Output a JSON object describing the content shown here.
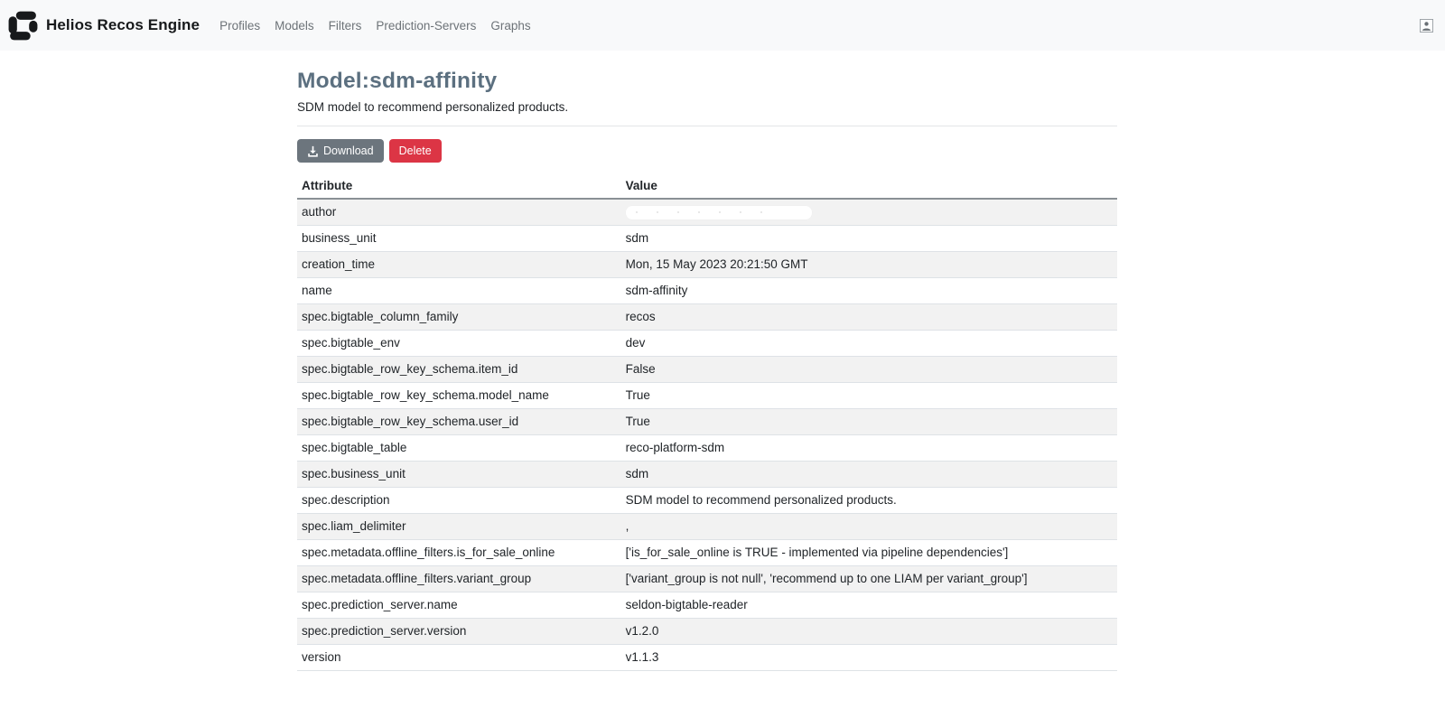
{
  "navbar": {
    "brand": "Helios Recos Engine",
    "items": [
      {
        "label": "Profiles"
      },
      {
        "label": "Models"
      },
      {
        "label": "Filters"
      },
      {
        "label": "Prediction-Servers"
      },
      {
        "label": "Graphs"
      }
    ],
    "icons": {
      "logo": "helios-logo-icon",
      "user": "user-avatar-icon"
    }
  },
  "page": {
    "title": "Model:sdm-affinity",
    "subtitle": "SDM model to recommend personalized products."
  },
  "toolbar": {
    "download_label": "Download",
    "delete_label": "Delete",
    "download_icon": "download-icon"
  },
  "colors": {
    "navbar_bg": "#f8f9fa",
    "title": "#5c7080",
    "button_secondary": "#6c757d",
    "button_danger": "#dc3545",
    "row_stripe": "#f2f2f2",
    "row_border": "#dee2e6"
  },
  "table": {
    "columns": [
      "Attribute",
      "Value"
    ],
    "rows": [
      {
        "attribute": "author",
        "value": "",
        "redacted": true
      },
      {
        "attribute": "business_unit",
        "value": "sdm"
      },
      {
        "attribute": "creation_time",
        "value": "Mon, 15 May 2023 20:21:50 GMT"
      },
      {
        "attribute": "name",
        "value": "sdm-affinity"
      },
      {
        "attribute": "spec.bigtable_column_family",
        "value": "recos"
      },
      {
        "attribute": "spec.bigtable_env",
        "value": "dev"
      },
      {
        "attribute": "spec.bigtable_row_key_schema.item_id",
        "value": "False"
      },
      {
        "attribute": "spec.bigtable_row_key_schema.model_name",
        "value": "True"
      },
      {
        "attribute": "spec.bigtable_row_key_schema.user_id",
        "value": "True"
      },
      {
        "attribute": "spec.bigtable_table",
        "value": "reco-platform-sdm"
      },
      {
        "attribute": "spec.business_unit",
        "value": "sdm"
      },
      {
        "attribute": "spec.description",
        "value": "SDM model to recommend personalized products."
      },
      {
        "attribute": "spec.liam_delimiter",
        "value": ","
      },
      {
        "attribute": "spec.metadata.offline_filters.is_for_sale_online",
        "value": "['is_for_sale_online is TRUE - implemented via pipeline dependencies']"
      },
      {
        "attribute": "spec.metadata.offline_filters.variant_group",
        "value": "['variant_group is not null', 'recommend up to one LIAM per variant_group']"
      },
      {
        "attribute": "spec.prediction_server.name",
        "value": "seldon-bigtable-reader"
      },
      {
        "attribute": "spec.prediction_server.version",
        "value": "v1.2.0"
      },
      {
        "attribute": "version",
        "value": "v1.1.3"
      }
    ]
  }
}
